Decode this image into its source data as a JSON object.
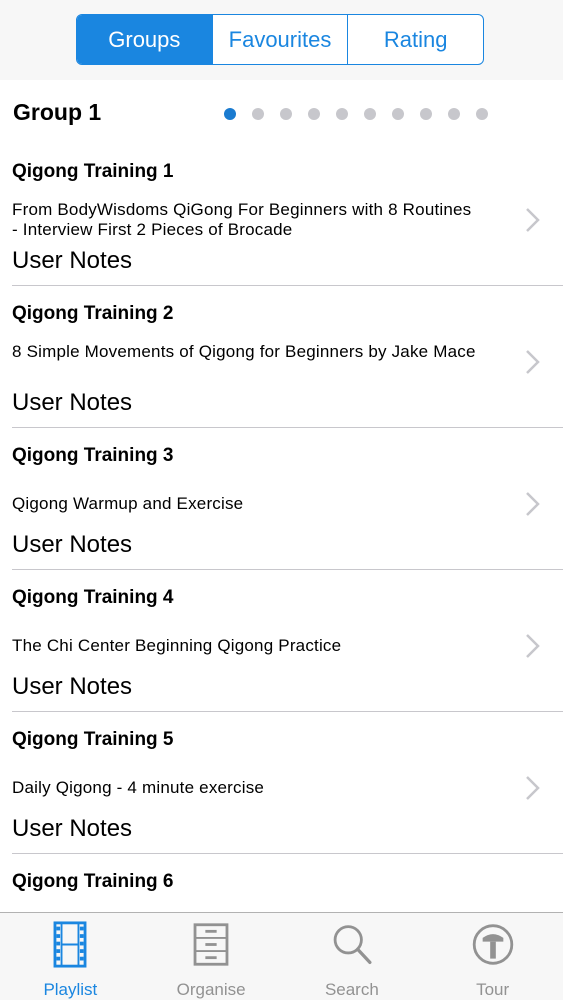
{
  "segmented": {
    "items": [
      {
        "label": "Groups",
        "active": true
      },
      {
        "label": "Favourites",
        "active": false
      },
      {
        "label": "Rating",
        "active": false
      }
    ]
  },
  "group": {
    "title": "Group 1",
    "page_count": 10,
    "current_page": 1
  },
  "rows": [
    {
      "title": "Qigong Training 1",
      "description": "From BodyWisdoms QiGong For Beginners with 8 Routines - Interview  First 2 Pieces of Brocade",
      "notes": "User Notes"
    },
    {
      "title": "Qigong Training 2",
      "description": "8 Simple Movements of Qigong for Beginners by Jake Mace",
      "notes": "User Notes"
    },
    {
      "title": "Qigong Training 3",
      "description": "Qigong Warmup and Exercise",
      "notes": "User Notes"
    },
    {
      "title": "Qigong Training 4",
      "description": "The Chi Center  Beginning Qigong Practice",
      "notes": "User Notes"
    },
    {
      "title": "Qigong Training 5",
      "description": "Daily Qigong - 4 minute exercise",
      "notes": "User Notes"
    },
    {
      "title": "Qigong Training 6",
      "description": "",
      "notes": ""
    }
  ],
  "tabs": [
    {
      "label": "Playlist",
      "icon": "film-icon",
      "active": true
    },
    {
      "label": "Organise",
      "icon": "cabinet-icon",
      "active": false
    },
    {
      "label": "Search",
      "icon": "search-icon",
      "active": false
    },
    {
      "label": "Tour",
      "icon": "tour-icon",
      "active": false
    }
  ],
  "colors": {
    "accent": "#1a86e0",
    "inactive": "#929292",
    "separator": "#c8c7cc"
  }
}
